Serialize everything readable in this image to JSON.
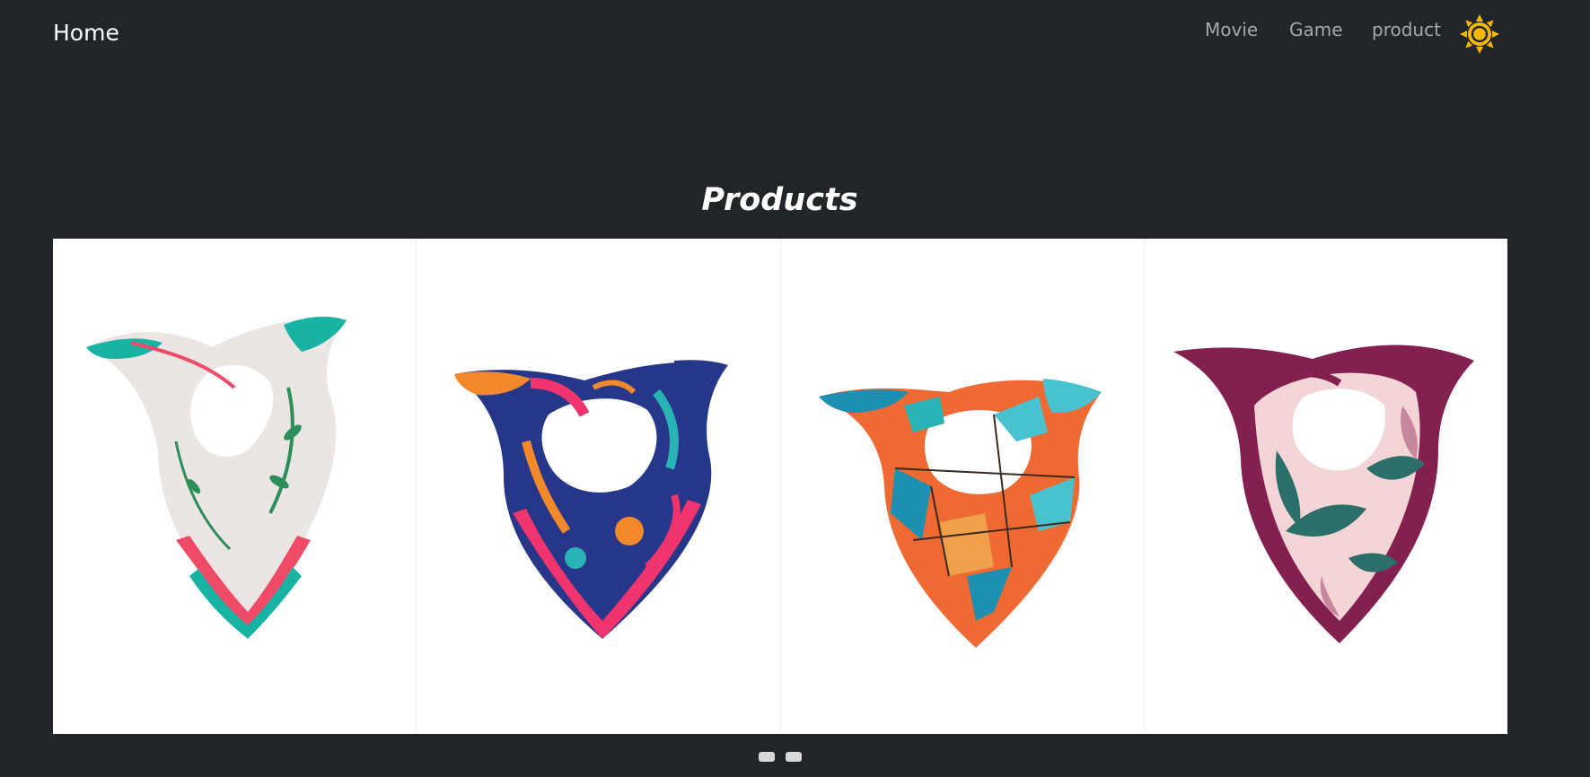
{
  "navbar": {
    "brand": "Home",
    "links": [
      "Movie",
      "Game",
      "product"
    ],
    "theme_icon": "sun-icon",
    "theme_color": "#f5b800"
  },
  "page": {
    "title": "Products"
  },
  "carousel": {
    "items": [
      {
        "icon": "scarf-floral-teal-icon",
        "colors": [
          "#ebe6e4",
          "#19b3a4",
          "#ef4a66",
          "#2c8f5a"
        ]
      },
      {
        "icon": "scarf-navy-pink-icon",
        "colors": [
          "#26378a",
          "#f0356e",
          "#f28a2c",
          "#2ab3b5"
        ]
      },
      {
        "icon": "scarf-geometric-orange-icon",
        "colors": [
          "#ef6a32",
          "#1d8fb2",
          "#49c2cf",
          "#f0a04a"
        ]
      },
      {
        "icon": "scarf-plum-leaf-icon",
        "colors": [
          "#84204f",
          "#f3d5d6",
          "#2c6f6a",
          "#c5869e"
        ]
      }
    ],
    "indicator_count": 2
  }
}
